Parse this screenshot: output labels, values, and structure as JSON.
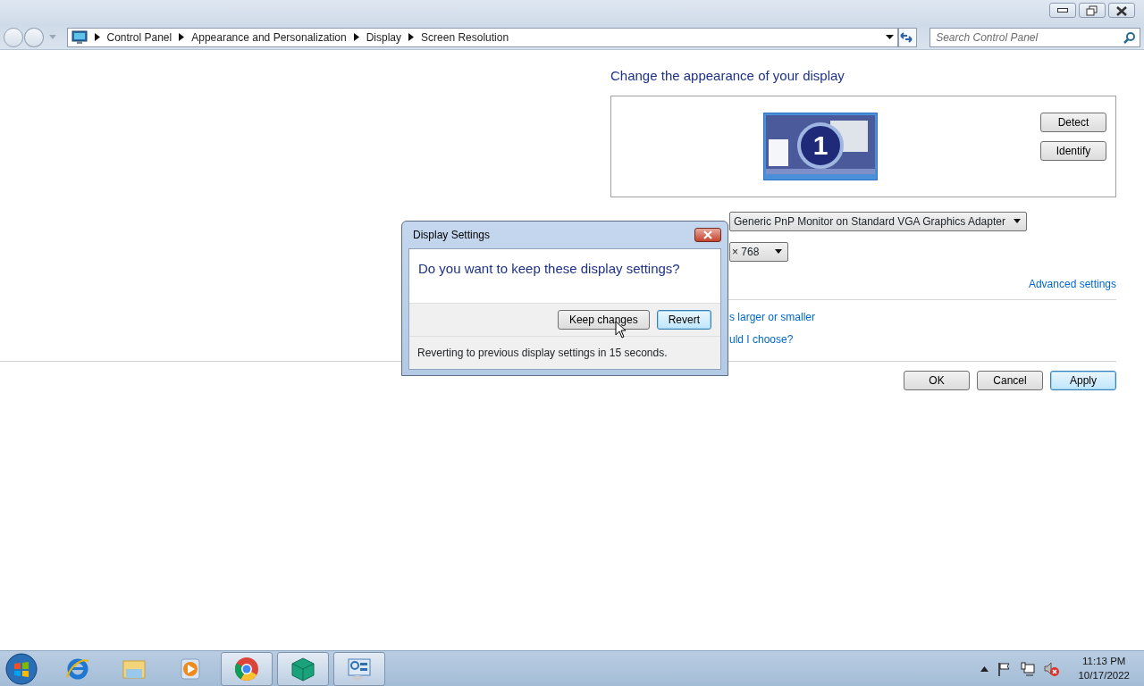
{
  "address_bar": {
    "breadcrumbs": [
      "Control Panel",
      "Appearance and Personalization",
      "Display",
      "Screen Resolution"
    ]
  },
  "search": {
    "placeholder": "Search Control Panel"
  },
  "heading": "Change the appearance of your display",
  "monitor_preview": {
    "number": "1"
  },
  "side_buttons": [
    "Detect",
    "Identify"
  ],
  "display_dropdown": {
    "value": "Generic PnP Monitor on Standard VGA Graphics Adapter"
  },
  "resolution_dropdown": {
    "value": "× 768"
  },
  "advanced_link": "Advanced settings",
  "links": [
    "s larger or smaller",
    "uld I choose?"
  ],
  "buttons": [
    {
      "label": "OK",
      "focused": false
    },
    {
      "label": "Cancel",
      "focused": false
    },
    {
      "label": "Apply",
      "focused": true
    }
  ],
  "dialog": {
    "title": "Display Settings",
    "question": "Do you want to keep these display settings?",
    "buttons": [
      {
        "label": "Keep changes",
        "focused": false
      },
      {
        "label": "Revert",
        "focused": true
      }
    ],
    "countdown": "Reverting to previous display settings in 15 seconds."
  },
  "taskbar": {
    "items": [
      {
        "kind": "ie",
        "open": false
      },
      {
        "kind": "folder",
        "open": false
      },
      {
        "kind": "media",
        "open": false
      },
      {
        "kind": "chrome",
        "open": true
      },
      {
        "kind": "package",
        "open": true
      },
      {
        "kind": "control",
        "open": true
      }
    ],
    "clock": {
      "time": "11:13 PM",
      "date": "10/17/2022"
    }
  }
}
